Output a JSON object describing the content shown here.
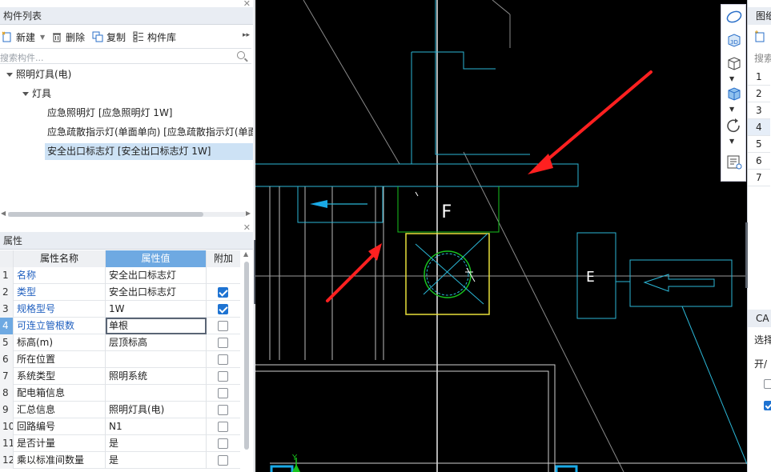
{
  "component_panel": {
    "title": "构件列表",
    "toolbar": {
      "new_label": "新建",
      "delete_label": "删除",
      "copy_label": "复制",
      "library_label": "构件库"
    },
    "search_placeholder": "搜索构件...",
    "tree": {
      "root": "照明灯具(电)",
      "group": "灯具",
      "items": [
        "应急照明灯 [应急照明灯 1W]",
        "应急疏散指示灯(单面单向) [应急疏散指示灯(单面",
        "安全出口标志灯 [安全出口标志灯 1W]"
      ],
      "selected_index": 2
    }
  },
  "property_panel": {
    "title": "属性",
    "columns": [
      "属性名称",
      "属性值",
      "附加"
    ],
    "rows": [
      {
        "no": "1",
        "name": "名称",
        "value": "安全出口标志灯",
        "extra": null,
        "blue": true
      },
      {
        "no": "2",
        "name": "类型",
        "value": "安全出口标志灯",
        "extra": true,
        "blue": true
      },
      {
        "no": "3",
        "name": "规格型号",
        "value": "1W",
        "extra": true,
        "blue": true
      },
      {
        "no": "4",
        "name": "可连立管根数",
        "value": "单根",
        "extra": false,
        "blue": true
      },
      {
        "no": "5",
        "name": "标高(m)",
        "value": "层顶标高",
        "extra": false,
        "blue": false
      },
      {
        "no": "6",
        "name": "所在位置",
        "value": "",
        "extra": false,
        "blue": false
      },
      {
        "no": "7",
        "name": "系统类型",
        "value": "照明系统",
        "extra": false,
        "blue": false
      },
      {
        "no": "8",
        "name": "配电箱信息",
        "value": "",
        "extra": false,
        "blue": false
      },
      {
        "no": "9",
        "name": "汇总信息",
        "value": "照明灯具(电)",
        "extra": false,
        "blue": false
      },
      {
        "no": "10",
        "name": "回路编号",
        "value": "N1",
        "extra": false,
        "blue": false
      },
      {
        "no": "11",
        "name": "是否计量",
        "value": "是",
        "extra": false,
        "blue": false
      },
      {
        "no": "12",
        "name": "乘以标准间数量",
        "value": "是",
        "extra": false,
        "blue": false
      }
    ],
    "current_row": 3
  },
  "drawing": {
    "label_f": "F",
    "label_e": "E"
  },
  "right_panel": {
    "title_top": "图纸",
    "search_partial": "搜索",
    "row_numbers": [
      "1",
      "2",
      "3",
      "4",
      "5",
      "6",
      "7"
    ],
    "cad_title": "CA",
    "select_label": "选择",
    "open_label": "开/"
  },
  "colors": {
    "canvas_bg": "#000000",
    "cad_cyan": "#2bb6d6",
    "cad_green": "#18c21e",
    "cad_yellow": "#e8e03a",
    "arrow_red": "#ff2020",
    "accent_blue": "#1e73d2"
  }
}
